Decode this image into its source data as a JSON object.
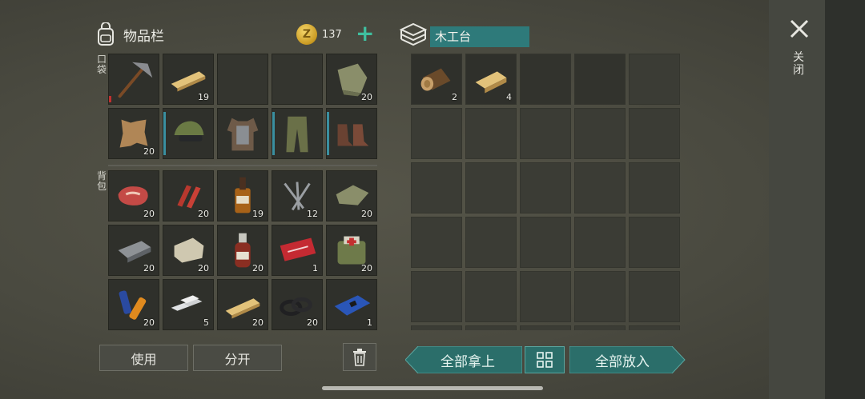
{
  "inventory": {
    "title": "物品栏",
    "coins": "137",
    "coin_symbol": "Z",
    "pocket_label": "口袋",
    "backpack_label": "背包",
    "pocket_row1": [
      {
        "item": "pickaxe",
        "count": ""
      },
      {
        "item": "wood-plank",
        "count": "19"
      },
      {
        "item": "",
        "count": ""
      },
      {
        "item": "",
        "count": ""
      },
      {
        "item": "cloth",
        "count": "20"
      }
    ],
    "pocket_row2": [
      {
        "item": "leather-hide",
        "count": "20"
      },
      {
        "item": "camo-cap",
        "count": ""
      },
      {
        "item": "armor-vest",
        "count": ""
      },
      {
        "item": "camo-pants",
        "count": ""
      },
      {
        "item": "boots",
        "count": ""
      }
    ],
    "backpack": [
      {
        "item": "raw-meat",
        "count": "20"
      },
      {
        "item": "bacon",
        "count": "20"
      },
      {
        "item": "whiskey",
        "count": "19"
      },
      {
        "item": "nails",
        "count": "12"
      },
      {
        "item": "cloth",
        "count": "20"
      },
      {
        "item": "iron-bar",
        "count": "20"
      },
      {
        "item": "stone",
        "count": "20"
      },
      {
        "item": "medicine-bottle",
        "count": "20"
      },
      {
        "item": "coupon",
        "count": "1"
      },
      {
        "item": "first-aid-bag",
        "count": "20"
      },
      {
        "item": "batteries",
        "count": "20"
      },
      {
        "item": "aluminum-bars",
        "count": "5"
      },
      {
        "item": "wood-plank",
        "count": "20"
      },
      {
        "item": "rubber-rings",
        "count": "20"
      },
      {
        "item": "circuit-board",
        "count": "1"
      }
    ],
    "buttons": {
      "use": "使用",
      "split": "分开"
    }
  },
  "chest": {
    "name": "木工台",
    "items": [
      {
        "item": "log",
        "count": "2"
      },
      {
        "item": "wood-plank",
        "count": "4"
      }
    ],
    "buttons": {
      "take_all": "全部拿上",
      "put_all": "全部放入"
    }
  },
  "close_label": "关闭",
  "colors": {
    "accent": "#2e7a7a",
    "plus": "#3fbf9f"
  }
}
